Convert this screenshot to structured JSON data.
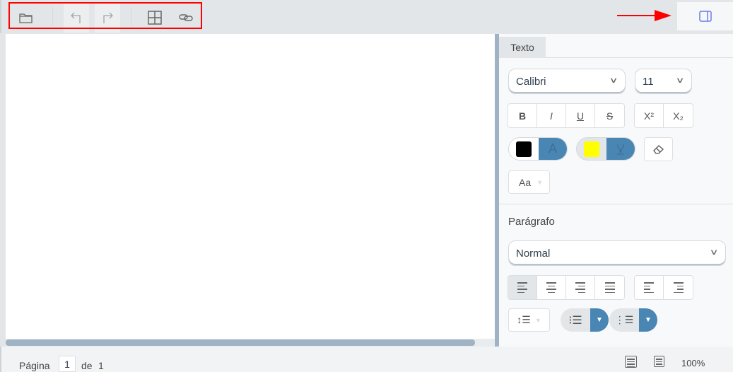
{
  "toolbar": {
    "icons": [
      "folder-open-icon",
      "undo-icon",
      "redo-icon",
      "table-icon",
      "link-icon"
    ],
    "panel_toggle_icon": "sidebar-right-icon"
  },
  "panel": {
    "tab": "Texto",
    "font": {
      "family": "Calibri",
      "size": "11"
    },
    "format_buttons": {
      "bold": "B",
      "italic": "I",
      "underline": "U",
      "strike": "S",
      "superscript": "X²",
      "subscript": "X₂"
    },
    "font_color": "#000000",
    "highlight_color": "#ffff00",
    "accent": "#4a86b4",
    "case_button": "Aa",
    "paragraph_label": "Parágrafo",
    "paragraph_style": "Normal",
    "active_alignment": "left"
  },
  "footer": {
    "page_label": "Página",
    "page": "1",
    "of_label": "de",
    "total": "1",
    "zoom": "100%"
  }
}
